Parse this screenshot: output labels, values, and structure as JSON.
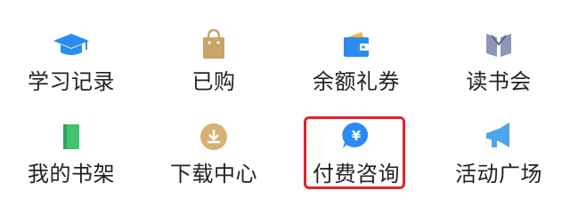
{
  "menu": {
    "items": [
      {
        "label": "学习记录",
        "icon": "graduation-cap-icon",
        "color": "#2a8bf2"
      },
      {
        "label": "已购",
        "icon": "shopping-bag-icon",
        "color": "#c9a46a"
      },
      {
        "label": "余额礼券",
        "icon": "wallet-icon",
        "color": "#2a8bf2"
      },
      {
        "label": "读书会",
        "icon": "book-club-icon",
        "color": "#6b7aa0"
      },
      {
        "label": "我的书架",
        "icon": "book-icon",
        "color": "#3ec46d"
      },
      {
        "label": "下载中心",
        "icon": "download-icon",
        "color": "#d8b075"
      },
      {
        "label": "付费咨询",
        "icon": "yuan-chat-icon",
        "color": "#2a8bf2"
      },
      {
        "label": "活动广场",
        "icon": "megaphone-icon",
        "color": "#4aa6ee"
      }
    ]
  },
  "highlight": {
    "color": "#e0242b"
  }
}
